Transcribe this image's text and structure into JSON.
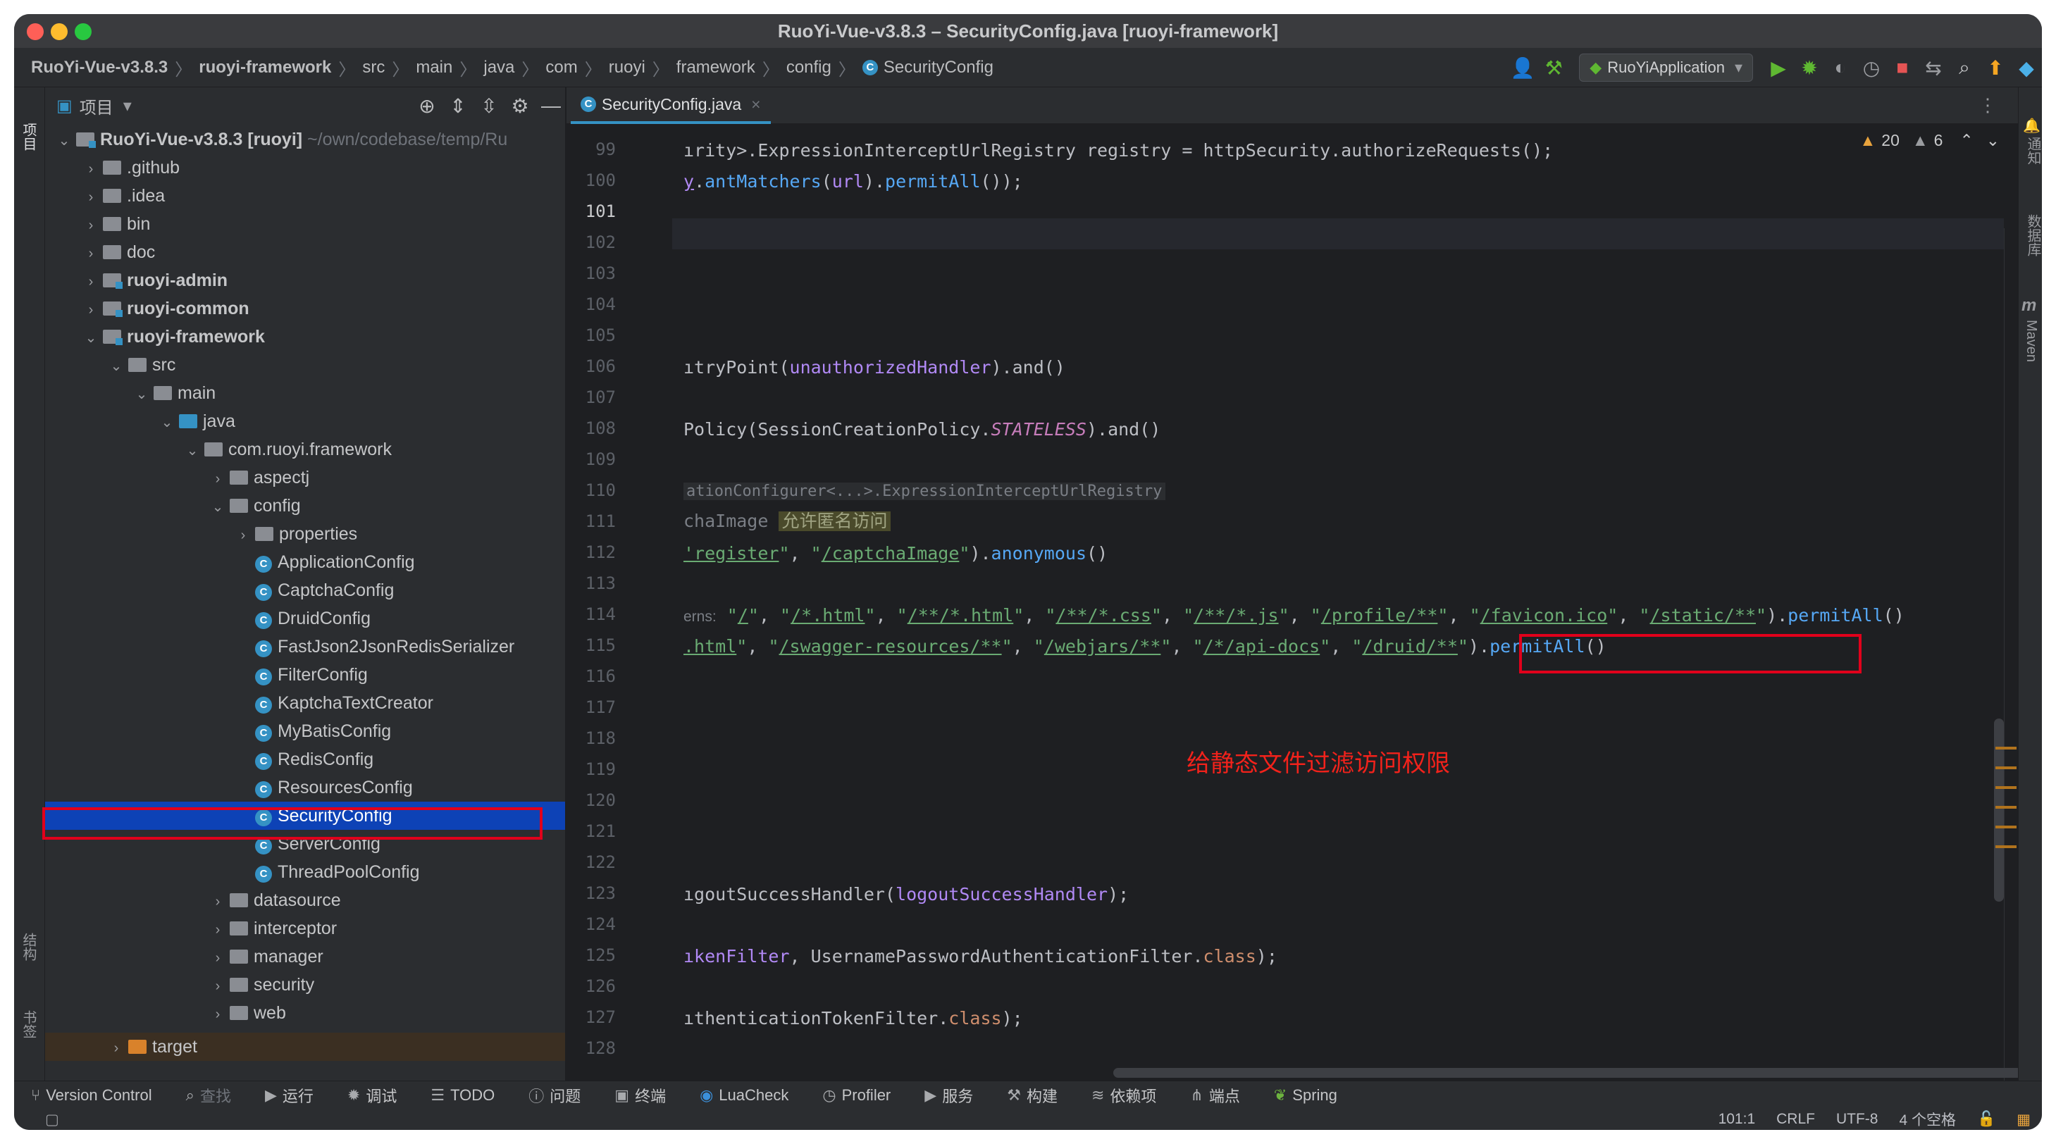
{
  "window": {
    "title": "RuoYi-Vue-v3.8.3 – SecurityConfig.java [ruoyi-framework]"
  },
  "breadcrumb": [
    "RuoYi-Vue-v3.8.3",
    "ruoyi-framework",
    "src",
    "main",
    "java",
    "com",
    "ruoyi",
    "framework",
    "config",
    "SecurityConfig"
  ],
  "toolbar": {
    "run_config": "RuoYiApplication"
  },
  "project_panel": {
    "title": "项目"
  },
  "left_strip": {
    "project": "项目",
    "structure": "结构",
    "bookmarks": "书签"
  },
  "right_strip": {
    "notifications": "通知",
    "database": "数据库",
    "maven": "Maven",
    "maven_m": "m"
  },
  "tree": {
    "root": {
      "name": "RuoYi-Vue-v3.8.3 [ruoyi]",
      "path": "~/own/codebase/temp/Ru"
    },
    "items": [
      ".github",
      ".idea",
      "bin",
      "doc",
      "ruoyi-admin",
      "ruoyi-common",
      "ruoyi-framework",
      "src",
      "main",
      "java",
      "com.ruoyi.framework",
      "aspectj",
      "config",
      "properties",
      "ApplicationConfig",
      "CaptchaConfig",
      "DruidConfig",
      "FastJson2JsonRedisSerializer",
      "FilterConfig",
      "KaptchaTextCreator",
      "MyBatisConfig",
      "RedisConfig",
      "ResourcesConfig",
      "SecurityConfig",
      "ServerConfig",
      "ThreadPoolConfig",
      "datasource",
      "interceptor",
      "manager",
      "security",
      "web",
      "target"
    ],
    "class_glyph": "C"
  },
  "editor": {
    "tab_label": "SecurityConfig.java",
    "inspections": {
      "warnings": "20",
      "weak_warnings": "6"
    },
    "line_numbers": [
      "99",
      "100",
      "101",
      "102",
      "103",
      "104",
      "105",
      "106",
      "107",
      "108",
      "109",
      "110",
      "111",
      "112",
      "113",
      "114",
      "115",
      "116",
      "117",
      "118",
      "119",
      "120",
      "121",
      "122",
      "123",
      "124",
      "125",
      "126",
      "127",
      "128"
    ],
    "inlay_hint": "ationConfigurer<...>.ExpressionInterceptUrlRegistry",
    "comment_hl": "允许匿名访问",
    "param_hint": "erns:",
    "annotation": "给静态文件过滤访问权限"
  },
  "bottom_tools": [
    "Version Control",
    "查找",
    "运行",
    "调试",
    "TODO",
    "问题",
    "终端",
    "LuaCheck",
    "Profiler",
    "服务",
    "构建",
    "依赖项",
    "端点",
    "Spring"
  ],
  "status": {
    "position": "101:1",
    "line_ending": "CRLF",
    "encoding": "UTF-8",
    "indent": "4 个空格"
  }
}
